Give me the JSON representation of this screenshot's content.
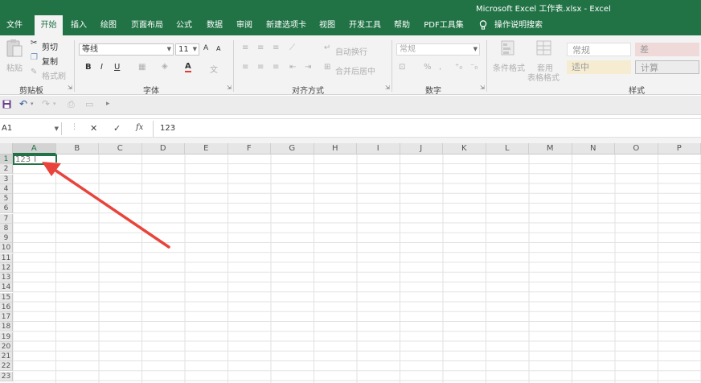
{
  "window": {
    "title": "Microsoft Excel 工作表.xlsx  -  Excel"
  },
  "tabs": [
    "文件",
    "开始",
    "插入",
    "绘图",
    "页面布局",
    "公式",
    "数据",
    "审阅",
    "新建选项卡",
    "视图",
    "开发工具",
    "帮助",
    "PDF工具集"
  ],
  "search": {
    "label": "操作说明搜索",
    "icon": "lightbulb-icon"
  },
  "ribbon": {
    "clipboard": {
      "paste": "粘贴",
      "cut": "剪切",
      "copy": "复制",
      "format_painter": "格式刷",
      "group": "剪贴板"
    },
    "font": {
      "name": "等线",
      "size": "11",
      "grow": "A",
      "shrink": "A",
      "bold": "B",
      "italic": "I",
      "underline": "U",
      "wen": "文",
      "group": "字体"
    },
    "alignment": {
      "wrap": "自动换行",
      "merge": "合并后居中",
      "group": "对齐方式"
    },
    "number": {
      "format": "常规",
      "percent": "%",
      "comma": ",",
      "group": "数字"
    },
    "styles": {
      "conditional_line1": "条件格式",
      "table_line1": "套用",
      "table_line2": "表格格式",
      "normal": "常规",
      "bad": "差",
      "neutral": "适中",
      "calc": "计算",
      "group": "样式"
    }
  },
  "formula_bar": {
    "name_box": "A1",
    "cancel": "✕",
    "enter": "✓",
    "fx": "fx",
    "value": "123"
  },
  "sheet": {
    "columns": [
      "A",
      "B",
      "C",
      "D",
      "E",
      "F",
      "G",
      "H",
      "I",
      "J",
      "K",
      "L",
      "M",
      "N",
      "O",
      "P"
    ],
    "rows": [
      "1",
      "2",
      "3",
      "4",
      "5",
      "6",
      "7",
      "8",
      "9",
      "10",
      "11",
      "12",
      "13",
      "14",
      "15",
      "16",
      "17",
      "18",
      "19",
      "20",
      "21",
      "22",
      "23"
    ],
    "active_cell_value": "123",
    "cursor": "I"
  },
  "colors": {
    "accent": "#217346",
    "arrow": "#e8443c"
  }
}
